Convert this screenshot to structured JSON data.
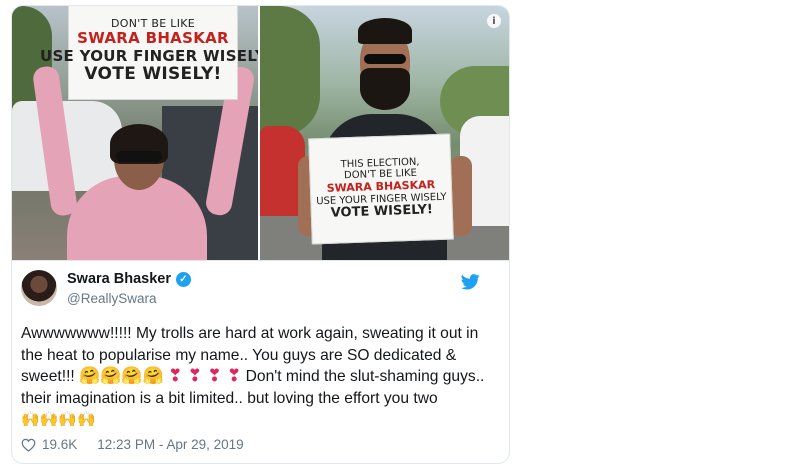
{
  "media": {
    "left_sign": {
      "lines": [
        "Don't be like",
        "Swara Bhaskar",
        "Use Your Finger Wisely",
        "Vote Wisely!"
      ]
    },
    "right_sign": {
      "lines": [
        "This Election,",
        "Don't Be Like",
        "Swara Bhaskar",
        "Use Your Finger Wisely",
        "Vote Wisely!"
      ]
    },
    "info_glyph": "i"
  },
  "tweet": {
    "author_name": "Swara Bhasker",
    "verified_glyph": "✓",
    "handle": "@ReallySwara",
    "text_part1": "Awwwwwww!!!!! My trolls are hard at work again, sweating it out in the heat to popularise my name.. You guys are SO dedicated & sweet!!!",
    "hug_emojis": "🤗🤗🤗🤗",
    "heart_emojis": "❣ ❣ ❣ ❣",
    "text_part2": "Don't mind the slut-shaming guys.. their imagination is a bit limited.. but loving the effort you two",
    "clap_emojis": "🙌🙌🙌🙌",
    "likes": "19.6K",
    "timestamp": "12:23 PM - Apr 29, 2019"
  },
  "icons": {
    "bird": "twitter-bird-icon",
    "heart": "heart-icon",
    "verified": "verified-badge-icon",
    "info": "info-icon"
  },
  "colors": {
    "twitter_blue": "#1da1f2",
    "text": "#14171a",
    "muted": "#657786",
    "border": "#e1e8ed",
    "sign_red": "#c4211d"
  }
}
